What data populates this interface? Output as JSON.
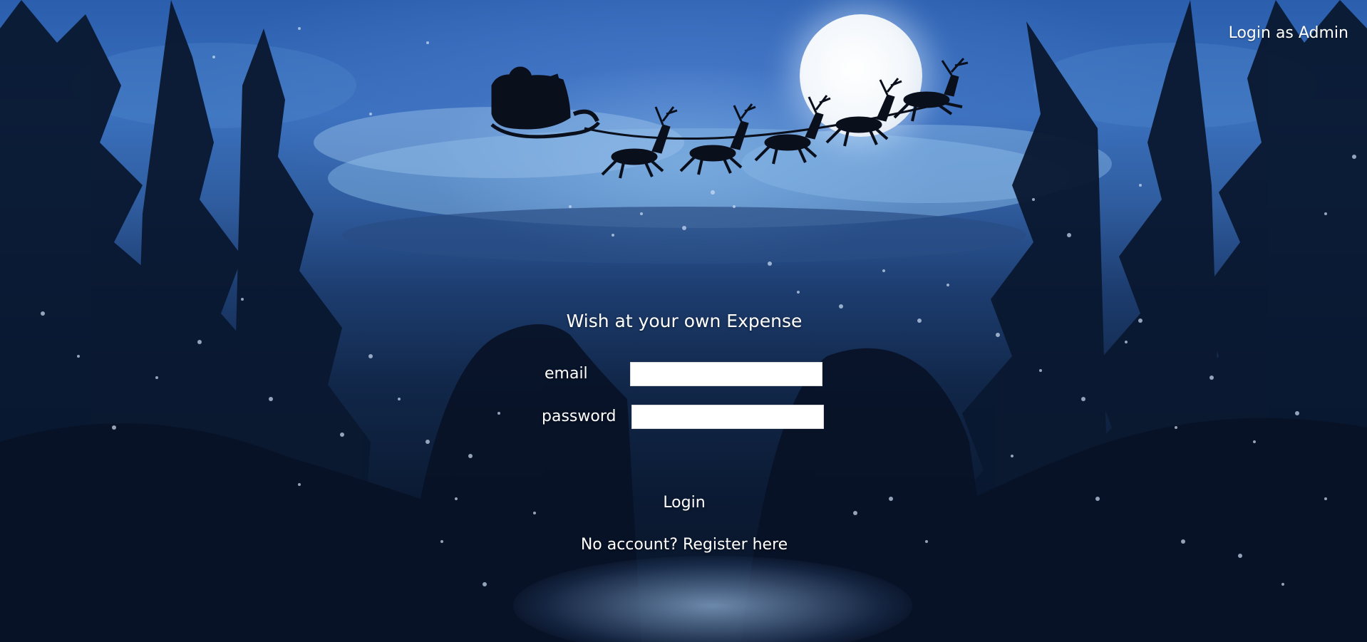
{
  "header": {
    "admin_link": "Login as Admin"
  },
  "form": {
    "title": "Wish at your own Expense",
    "email_label": "email",
    "email_value": "",
    "password_label": "password",
    "password_value": "",
    "login_label": "Login",
    "register_link": "No account? Register here"
  },
  "background": {
    "scene": "snowy night forest with full moon and Santa's sleigh with reindeer",
    "sky_color": "#2b5fae",
    "forest_color": "#0b1a33",
    "moon_color": "#f3f7fb"
  }
}
